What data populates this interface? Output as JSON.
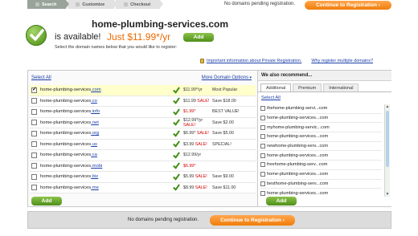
{
  "steps": [
    {
      "label": "Search",
      "active": true
    },
    {
      "label": "Customize",
      "active": false
    },
    {
      "label": "Checkout",
      "active": false
    }
  ],
  "cart": {
    "pending_text": "No domains pending registration.",
    "continue_label": "Continue to Registration ›"
  },
  "header": {
    "domain": "home-plumbing-services.com",
    "available_text": "is available!",
    "price_text": "Just $11.99*/yr",
    "add_label": "Add",
    "instruction": "Select the domain names below that you would like to register:"
  },
  "info_links": {
    "private_registration": "Important information about Private Registration.",
    "why_multiple": "Why register multiple domains?"
  },
  "left": {
    "select_all": "Select All",
    "more_options": "More Domain Options",
    "add_label": "Add",
    "rows": [
      {
        "name": "home-plumbing-services",
        "tld": ".com",
        "checked": true,
        "price": "$11.99*/yr",
        "sale": "",
        "price_warn": false,
        "note": "Most Popular"
      },
      {
        "name": "home-plumbing-services",
        "tld": ".co",
        "checked": false,
        "price": "$11.99",
        "sale": "SALE!",
        "price_warn": false,
        "note": "Save $18.00"
      },
      {
        "name": "home-plumbing-services",
        "tld": ".info",
        "checked": false,
        "price": "$1.99*",
        "sale": "",
        "price_warn": true,
        "note": "BEST VALUE!"
      },
      {
        "name": "home-plumbing-services",
        "tld": ".net",
        "checked": false,
        "price": "$12.99*/yr",
        "sale": "SALE!",
        "price_warn": false,
        "note": "Save $2.00"
      },
      {
        "name": "home-plumbing-services",
        "tld": ".org",
        "checked": false,
        "price": "$6.99*",
        "sale": "SALE!",
        "price_warn": false,
        "note": "Save $5.00"
      },
      {
        "name": "home-plumbing-services",
        "tld": ".us",
        "checked": false,
        "price": "$3.99",
        "sale": "SALE!",
        "price_warn": false,
        "note": "SPECIAL!"
      },
      {
        "name": "home-plumbing-services",
        "tld": ".ca",
        "checked": false,
        "price": "$12.99/yr",
        "sale": "",
        "price_warn": false,
        "note": ""
      },
      {
        "name": "home-plumbing-services",
        "tld": ".mobi",
        "checked": false,
        "price": "$6.99*",
        "sale": "",
        "price_warn": true,
        "note": ""
      },
      {
        "name": "home-plumbing-services",
        "tld": ".biz",
        "checked": false,
        "price": "$5.99",
        "sale": "SALE!",
        "price_warn": false,
        "note": "Save $9.00"
      },
      {
        "name": "home-plumbing-services",
        "tld": ".me",
        "checked": false,
        "price": "$8.99",
        "sale": "SALE!",
        "price_warn": false,
        "note": "Save $11.00"
      }
    ]
  },
  "right": {
    "title": "We also recommend...",
    "tabs": [
      {
        "label": "Additional",
        "active": true
      },
      {
        "label": "Premium",
        "active": false
      },
      {
        "label": "International",
        "active": false
      }
    ],
    "select_all": "Select All",
    "add_label": "Add",
    "items": [
      "thehome-plumbing-servi...com",
      "home-plumbing-services...com",
      "myhome-plumbing-servic...com",
      "home-plumbing-services...com",
      "newhome-plumbing-serv...com",
      "home-plumbing-services...com",
      "freehome-plumbing-serv...com",
      "home-plumbing-services...com",
      "besthome-plumbing-serv...com",
      "home-plumbing-services...com"
    ]
  },
  "colors": {
    "orange": "#f07d0a",
    "green": "#4f8f1a",
    "link": "#1a3ea8",
    "sale": "#d40000"
  }
}
